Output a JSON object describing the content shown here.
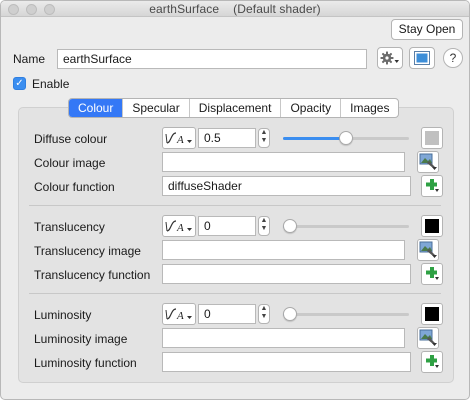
{
  "window": {
    "title": "earthSurface",
    "subtitle": "(Default shader)"
  },
  "header": {
    "stay_open_label": "Stay Open",
    "name_label": "Name",
    "name_value": "earthSurface",
    "help_label": "?",
    "enable_label": "Enable",
    "enable_checked": true
  },
  "tabs": [
    {
      "label": "Colour",
      "active": true
    },
    {
      "label": "Specular"
    },
    {
      "label": "Displacement"
    },
    {
      "label": "Opacity"
    },
    {
      "label": "Images"
    }
  ],
  "groups": [
    {
      "value_label": "Diffuse colour",
      "value": "0.5",
      "slider_level": 0.5,
      "swatch_color": "#c0c0c0",
      "image_label": "Colour image",
      "image_value": "",
      "function_label": "Colour function",
      "function_value": "diffuseShader"
    },
    {
      "value_label": "Translucency",
      "value": "0",
      "slider_level": 0,
      "swatch_color": "#000000",
      "image_label": "Translucency image",
      "image_value": "",
      "function_label": "Translucency function",
      "function_value": ""
    },
    {
      "value_label": "Luminosity",
      "value": "0",
      "slider_level": 0,
      "swatch_color": "#000000",
      "image_label": "Luminosity image",
      "image_value": "",
      "function_label": "Luminosity function",
      "function_value": ""
    }
  ],
  "icons": {
    "settings": "gear-icon",
    "preview": "image-preview-icon",
    "curve": "curve-function-icon",
    "image_browse": "image-browse-icon",
    "add_function": "add-function-icon"
  },
  "colors": {
    "accent": "#3478f6",
    "plus_green": "#2ea043"
  }
}
